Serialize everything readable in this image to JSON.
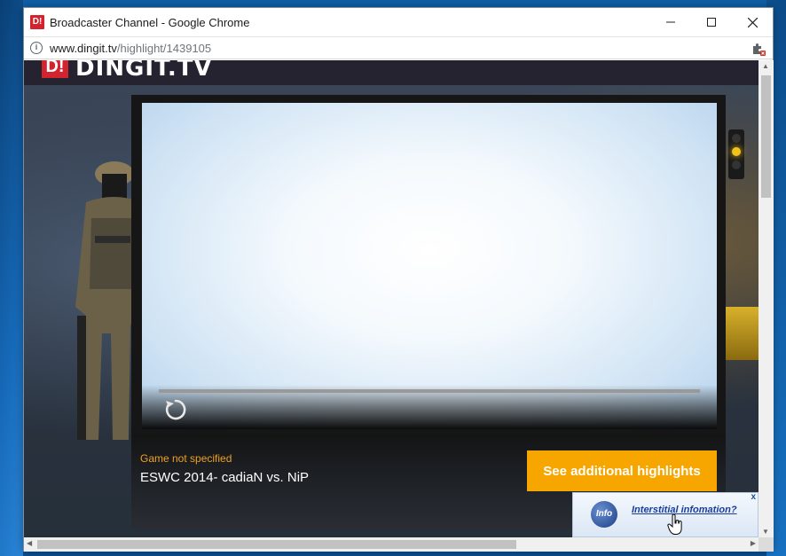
{
  "window": {
    "title": "Broadcaster Channel - Google Chrome",
    "app_icon_text": "D!",
    "controls": {
      "minimize": "—",
      "maximize": "☐",
      "close": "✕"
    }
  },
  "address_bar": {
    "host": "www.dingit.tv",
    "path": "/highlight/1439105",
    "info_glyph": "i"
  },
  "site": {
    "logo_mark": "D!",
    "logo_text": "DINGIT.TV"
  },
  "player": {
    "progress": 0,
    "replay_icon": "replay-icon"
  },
  "highlight": {
    "game_label": "Game not specified",
    "title": "ESWC 2014- cadiaN vs. NiP",
    "cta_label": "See additional highlights"
  },
  "ad": {
    "close_label": "x",
    "icon_text": "Info",
    "link_text": "Interstitial infomation?"
  },
  "scrollbars": {
    "up": "▲",
    "down": "▼",
    "left": "◀",
    "right": "▶"
  }
}
